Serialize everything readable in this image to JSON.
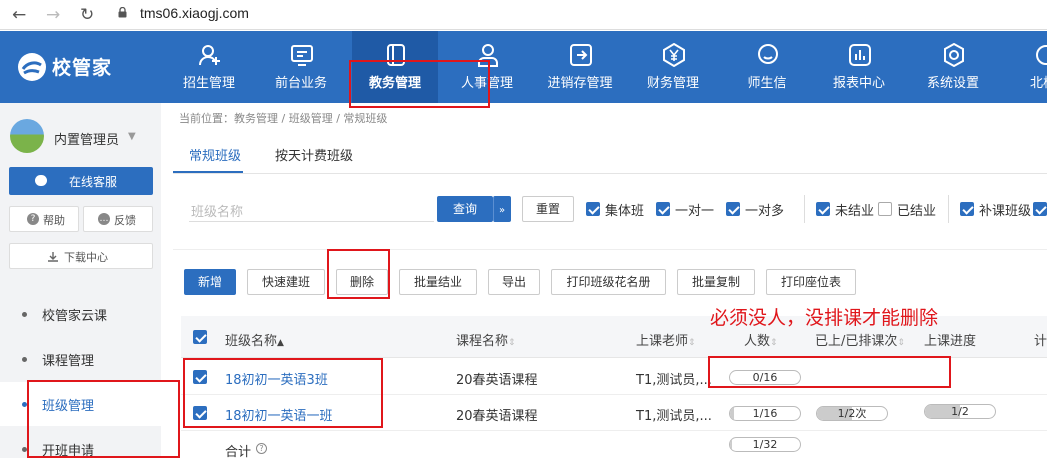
{
  "browser": {
    "url": "tms06.xiaogj.com",
    "back_icon": "←",
    "forward_icon": "→",
    "reload_icon": "↻"
  },
  "brand": {
    "name": "校管家",
    "color": "#2c6ebf",
    "annotation_color": "#e0161b"
  },
  "topnav": {
    "items": [
      {
        "label": "招生管理",
        "icon": "user-add-icon"
      },
      {
        "label": "前台业务",
        "icon": "monitor-icon"
      },
      {
        "label": "教务管理",
        "icon": "book-icon",
        "active": true
      },
      {
        "label": "人事管理",
        "icon": "person-icon"
      },
      {
        "label": "进销存管理",
        "icon": "inventory-icon"
      },
      {
        "label": "财务管理",
        "icon": "yen-icon"
      },
      {
        "label": "师生信",
        "icon": "chat-icon"
      },
      {
        "label": "报表中心",
        "icon": "report-icon"
      },
      {
        "label": "系统设置",
        "icon": "settings-icon"
      },
      {
        "label": "北极",
        "icon": "more-icon"
      }
    ]
  },
  "sidebar": {
    "user_name": "内置管理员",
    "service_label": "在线客服",
    "help_label": "帮助",
    "feedback_label": "反馈",
    "download_label": "下载中心",
    "links": [
      {
        "label": "校管家云课"
      },
      {
        "label": "课程管理"
      },
      {
        "label": "班级管理",
        "active": true
      },
      {
        "label": "开班申请"
      }
    ]
  },
  "breadcrumb": "当前位置：教务管理 / 班级管理 / 常规班级",
  "tabs": [
    {
      "label": "常规班级",
      "active": true
    },
    {
      "label": "按天计费班级"
    }
  ],
  "filters": {
    "search_placeholder": "班级名称",
    "query_label": "查询",
    "reset_label": "重置",
    "checks": [
      {
        "label": "集体班",
        "checked": true
      },
      {
        "label": "一对一",
        "checked": true
      },
      {
        "label": "一对多",
        "checked": true
      },
      {
        "label": "未结业",
        "checked": true
      },
      {
        "label": "已结业",
        "checked": false
      },
      {
        "label": "补课班级",
        "checked": true
      }
    ]
  },
  "toolbar": {
    "add": "新增",
    "quick_create": "快速建班",
    "delete": "删除",
    "batch_finish": "批量结业",
    "export": "导出",
    "print_roster": "打印班级花名册",
    "batch_copy": "批量复制",
    "print_seats": "打印座位表"
  },
  "table": {
    "headers": {
      "name": "班级名称",
      "course": "课程名称",
      "teacher": "上课老师",
      "count": "人数",
      "lessons": "已上/已排课次",
      "progress": "上课进度",
      "extra": "计"
    },
    "rows": [
      {
        "name": "18初初一英语3班",
        "course": "20春英语课程",
        "teacher": "T1,测试员,...",
        "count": "0/16",
        "count_frac": 0,
        "lessons": "",
        "progress": "",
        "checked": true
      },
      {
        "name": "18初初一英语一班",
        "course": "20春英语课程",
        "teacher": "T1,测试员,...",
        "count": "1/16",
        "count_frac": 0.0625,
        "lessons": "1/2次",
        "lessons_frac": 0.5,
        "progress": "1/2",
        "progress_frac": 0.5,
        "checked": true
      }
    ],
    "total_label": "合计",
    "total_count": "1/32",
    "total_frac": 0.03125
  },
  "annotation": {
    "note": "必须没人，没排课才能删除"
  }
}
